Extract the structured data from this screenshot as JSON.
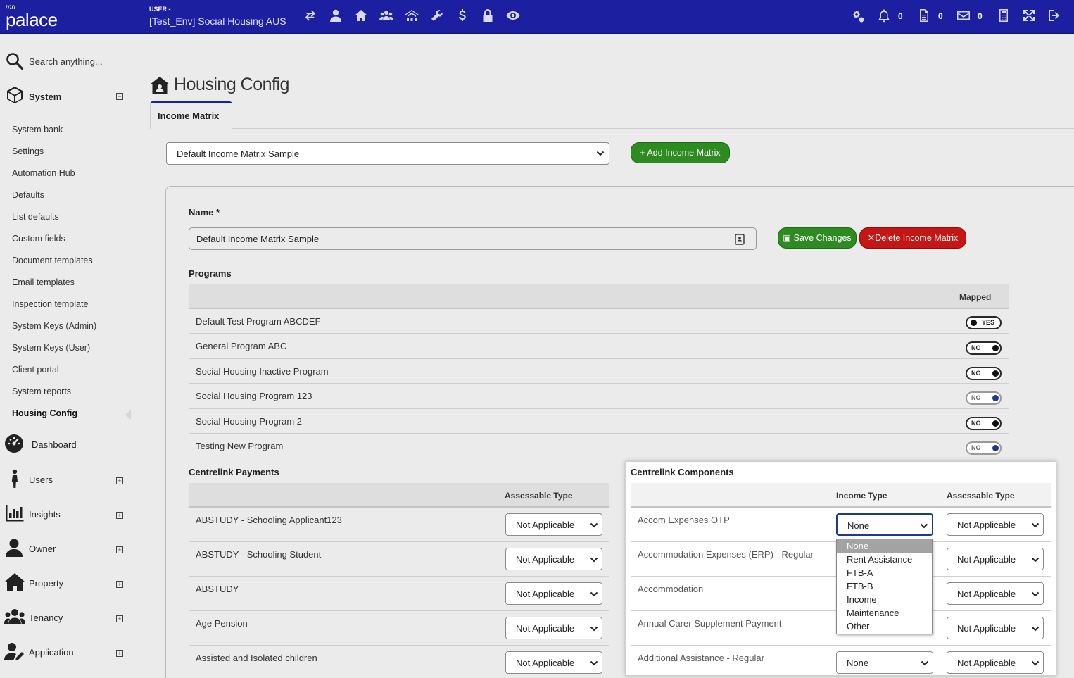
{
  "topbar": {
    "logo_small": "mri",
    "logo_text": "palace",
    "user_label": "USER -",
    "user_value": "[Test_Env] Social Housing AUS",
    "notifications_count": "0",
    "documents_count": "0",
    "messages_count": "0"
  },
  "sidebar": {
    "search_placeholder": "Search anything...",
    "system_label": "System",
    "system_items": [
      "System bank",
      "Settings",
      "Automation Hub",
      "Defaults",
      "List defaults",
      "Custom fields",
      "Document templates",
      "Email templates",
      "Inspection template",
      "System Keys (Admin)",
      "System Keys (User)",
      "Client portal",
      "System reports",
      "Housing Config"
    ],
    "nav": [
      "Dashboard",
      "Users",
      "Insights",
      "Owner",
      "Property",
      "Tenancy",
      "Application"
    ]
  },
  "page": {
    "title": "Housing Config",
    "tab": "Income Matrix",
    "matrix_select": "Default Income Matrix Sample",
    "add_button": "+ Add Income Matrix",
    "name_label": "Name *",
    "name_value": "Default Income Matrix Sample",
    "save_button": "Save Changes",
    "delete_button": "Delete Income Matrix"
  },
  "programs": {
    "title": "Programs",
    "mapped_header": "Mapped",
    "rows": [
      {
        "name": "Default Test Program ABCDEF",
        "mapped": "YES"
      },
      {
        "name": "General Program ABC",
        "mapped": "NO"
      },
      {
        "name": "Social Housing Inactive Program",
        "mapped": "NO"
      },
      {
        "name": "Social Housing Program 123",
        "mapped": "NO"
      },
      {
        "name": "Social Housing Program 2",
        "mapped": "NO"
      },
      {
        "name": "Testing New Program",
        "mapped": "NO"
      }
    ]
  },
  "payments": {
    "title": "Centrelink Payments",
    "header": "Assessable Type",
    "rows": [
      {
        "name": "ABSTUDY - Schooling Applicant123",
        "type": "Not Applicable"
      },
      {
        "name": "ABSTUDY - Schooling Student",
        "type": "Not Applicable"
      },
      {
        "name": "ABSTUDY",
        "type": "Not Applicable"
      },
      {
        "name": "Age Pension",
        "type": "Not Applicable"
      },
      {
        "name": "Assisted and Isolated children",
        "type": "Not Applicable"
      }
    ]
  },
  "components": {
    "title": "Centrelink Components",
    "income_header": "Income Type",
    "assessable_header": "Assessable Type",
    "rows": [
      {
        "name": "Accom Expenses OTP",
        "income": "None",
        "type": "Not Applicable"
      },
      {
        "name": "Accommodation Expenses (ERP) - Regular",
        "income": "",
        "type": "Not Applicable"
      },
      {
        "name": "Accommodation",
        "income": "",
        "type": "Not Applicable"
      },
      {
        "name": "Annual Carer Supplement Payment",
        "income": "",
        "type": "Not Applicable"
      },
      {
        "name": "Additional Assistance - Regular",
        "income": "None",
        "type": "Not Applicable"
      }
    ],
    "dropdown_options": [
      "None",
      "Rent Assistance",
      "FTB-A",
      "FTB-B",
      "Income",
      "Maintenance",
      "Other"
    ]
  },
  "colors": {
    "topbar": "#1b1fa0",
    "green_button": "#2e8b22",
    "red_button": "#c51616"
  }
}
